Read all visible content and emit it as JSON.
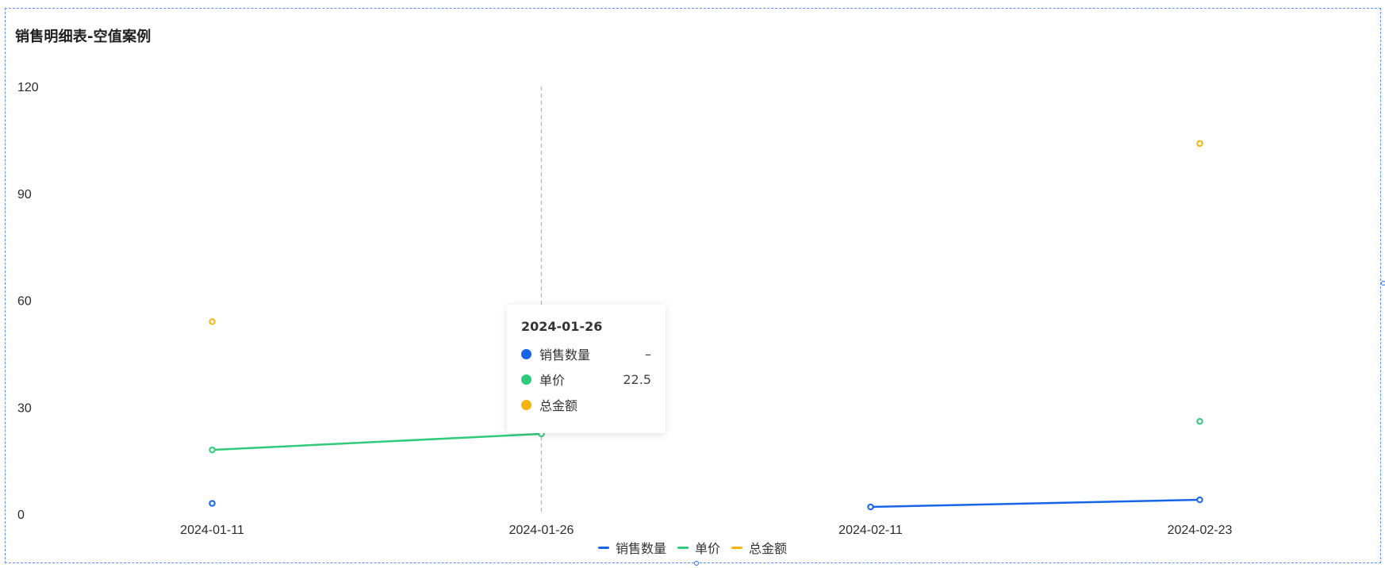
{
  "chart_data": {
    "type": "line",
    "title": "销售明细表-空值案例",
    "categories": [
      "2024-01-11",
      "2024-01-26",
      "2024-02-11",
      "2024-02-23"
    ],
    "ylim": [
      0,
      120
    ],
    "yticks": [
      0,
      30,
      60,
      90,
      120
    ],
    "grid": false,
    "legend_position": "bottom-center",
    "series": [
      {
        "name": "销售数量",
        "values": [
          3,
          null,
          2,
          4
        ],
        "color": "#1565e8"
      },
      {
        "name": "单价",
        "values": [
          18,
          22.5,
          null,
          26
        ],
        "color": "#2fcb7a"
      },
      {
        "name": "总金额",
        "values": [
          54,
          null,
          null,
          104
        ],
        "color": "#f5b30e"
      }
    ]
  },
  "tooltip": {
    "title": "2024-01-26",
    "rows": [
      {
        "name": "销售数量",
        "value": "–",
        "color": "#1565e8"
      },
      {
        "name": "单价",
        "value": "22.5",
        "color": "#2fcb7a"
      },
      {
        "name": "总金额",
        "value": "",
        "color": "#f5b30e"
      }
    ]
  },
  "legend": [
    {
      "label": "销售数量",
      "color": "#1565e8"
    },
    {
      "label": "单价",
      "color": "#2fcb7a"
    },
    {
      "label": "总金额",
      "color": "#f5b30e"
    }
  ]
}
